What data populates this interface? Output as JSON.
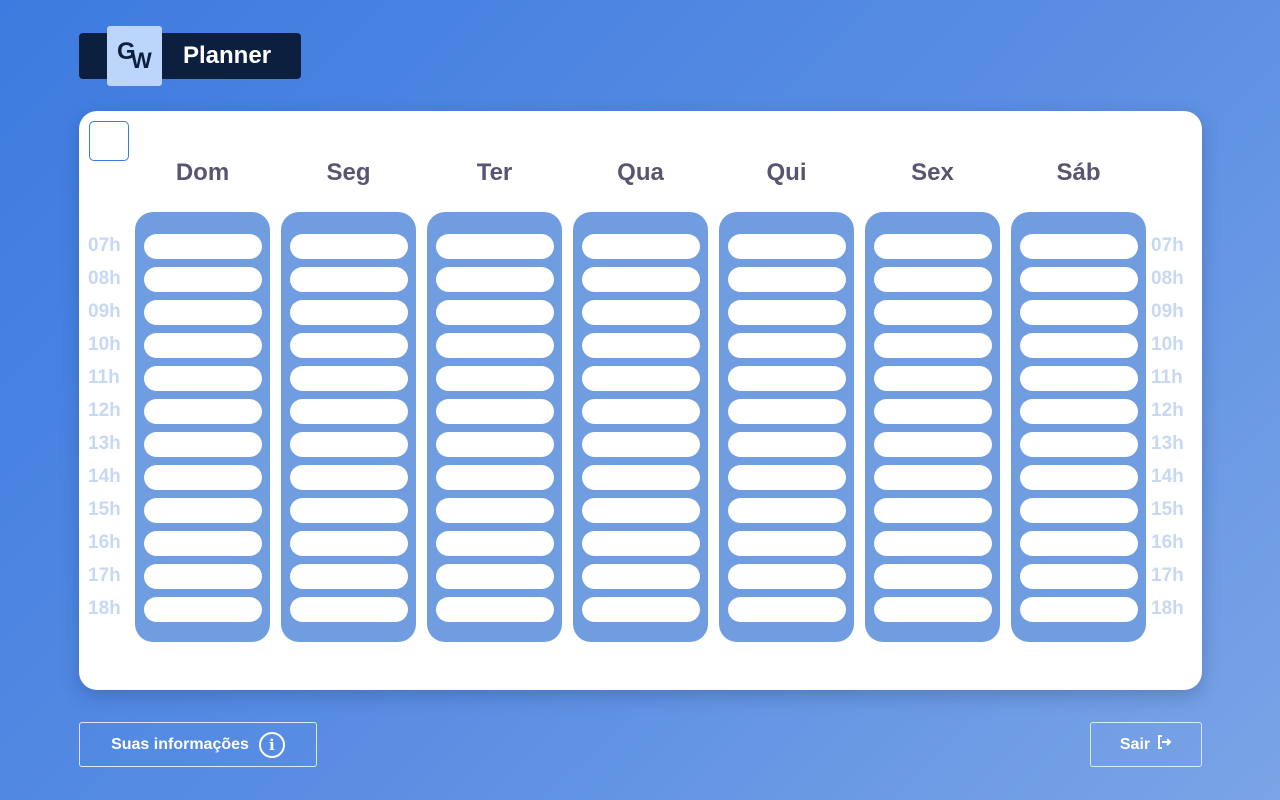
{
  "app": {
    "logo_letters": "GW",
    "title": "Planner"
  },
  "days": [
    "Dom",
    "Seg",
    "Ter",
    "Qua",
    "Qui",
    "Sex",
    "Sáb"
  ],
  "hours": [
    "07h",
    "08h",
    "09h",
    "10h",
    "11h",
    "12h",
    "13h",
    "14h",
    "15h",
    "16h",
    "17h",
    "18h"
  ],
  "footer": {
    "info_label": "Suas informações",
    "exit_label": "Sair"
  },
  "colors": {
    "background": "#3d7be0",
    "brand_dark": "#0c1f3f",
    "day_column": "#6f9de0",
    "day_header_text": "#5b5470",
    "hour_label": "#c7d8f2"
  },
  "icons": {
    "info": "info-circle-icon",
    "exit": "exit-icon"
  }
}
